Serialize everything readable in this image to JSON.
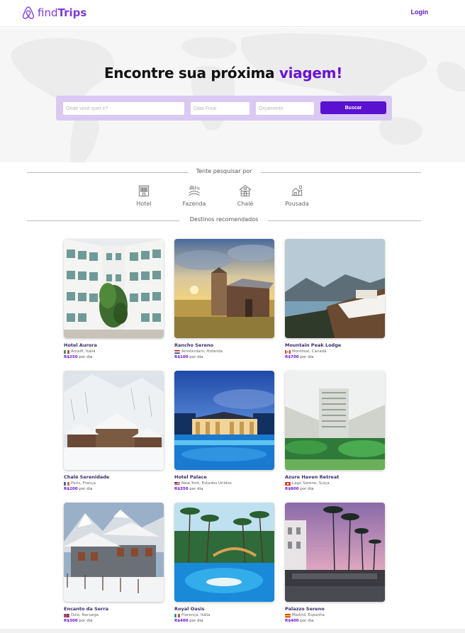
{
  "header": {
    "logo_prefix": "find",
    "logo_bold": "Trips",
    "login_label": "Login",
    "brand_color": "#7d3cd8"
  },
  "hero": {
    "title_main": "Encontre sua próxima ",
    "title_accent": "viagem!",
    "accent_color": "#6a14d6"
  },
  "search": {
    "destination_placeholder": "Onde você quer ir?",
    "date_placeholder": "Data Final",
    "budget_placeholder": "Orçamento",
    "button_label": "Buscar",
    "box_color": "#d9c9f3",
    "button_color": "#5a10cf"
  },
  "try_section": {
    "label": "Tente pesquisar por",
    "categories": [
      {
        "label": "Hotel",
        "icon": "hotel-building-icon"
      },
      {
        "label": "Fazenda",
        "icon": "farm-icon"
      },
      {
        "label": "Chalé",
        "icon": "chalet-icon"
      },
      {
        "label": "Pousada",
        "icon": "inn-icon"
      }
    ]
  },
  "destinations": {
    "label": "Destinos recomendados",
    "per_day": "por dia",
    "items": [
      {
        "name": "Hotel Aurora",
        "location": "Amalfi, Itália",
        "price": "R$250",
        "flag": "italy-flag-icon"
      },
      {
        "name": "Rancho Sereno",
        "location": "Amsterdam, Holanda",
        "price": "R$100",
        "flag": "netherlands-flag-icon"
      },
      {
        "name": "Mountain Peak Lodge",
        "location": "Montreal, Canadá",
        "price": "R$700",
        "flag": "canada-flag-icon"
      },
      {
        "name": "Chalé Serenidade",
        "location": "Paris, França",
        "price": "R$200",
        "flag": "france-flag-icon"
      },
      {
        "name": "Hotel Palace",
        "location": "New York, Estados Unidos",
        "price": "R$350",
        "flag": "usa-flag-icon"
      },
      {
        "name": "Azure Haven Retreat",
        "location": "Lago Sereno, Suiça",
        "price": "R$800",
        "flag": "switzerland-flag-icon"
      },
      {
        "name": "Encanto da Serra",
        "location": "Oslo, Noruega",
        "price": "R$300",
        "flag": "norway-flag-icon"
      },
      {
        "name": "Royal Oasis",
        "location": "Florença, Itália",
        "price": "R$400",
        "flag": "italy-flag-icon"
      },
      {
        "name": "Palazzo Sereno",
        "location": "Madrid, Espanha",
        "price": "R$400",
        "flag": "spain-flag-icon"
      }
    ]
  }
}
